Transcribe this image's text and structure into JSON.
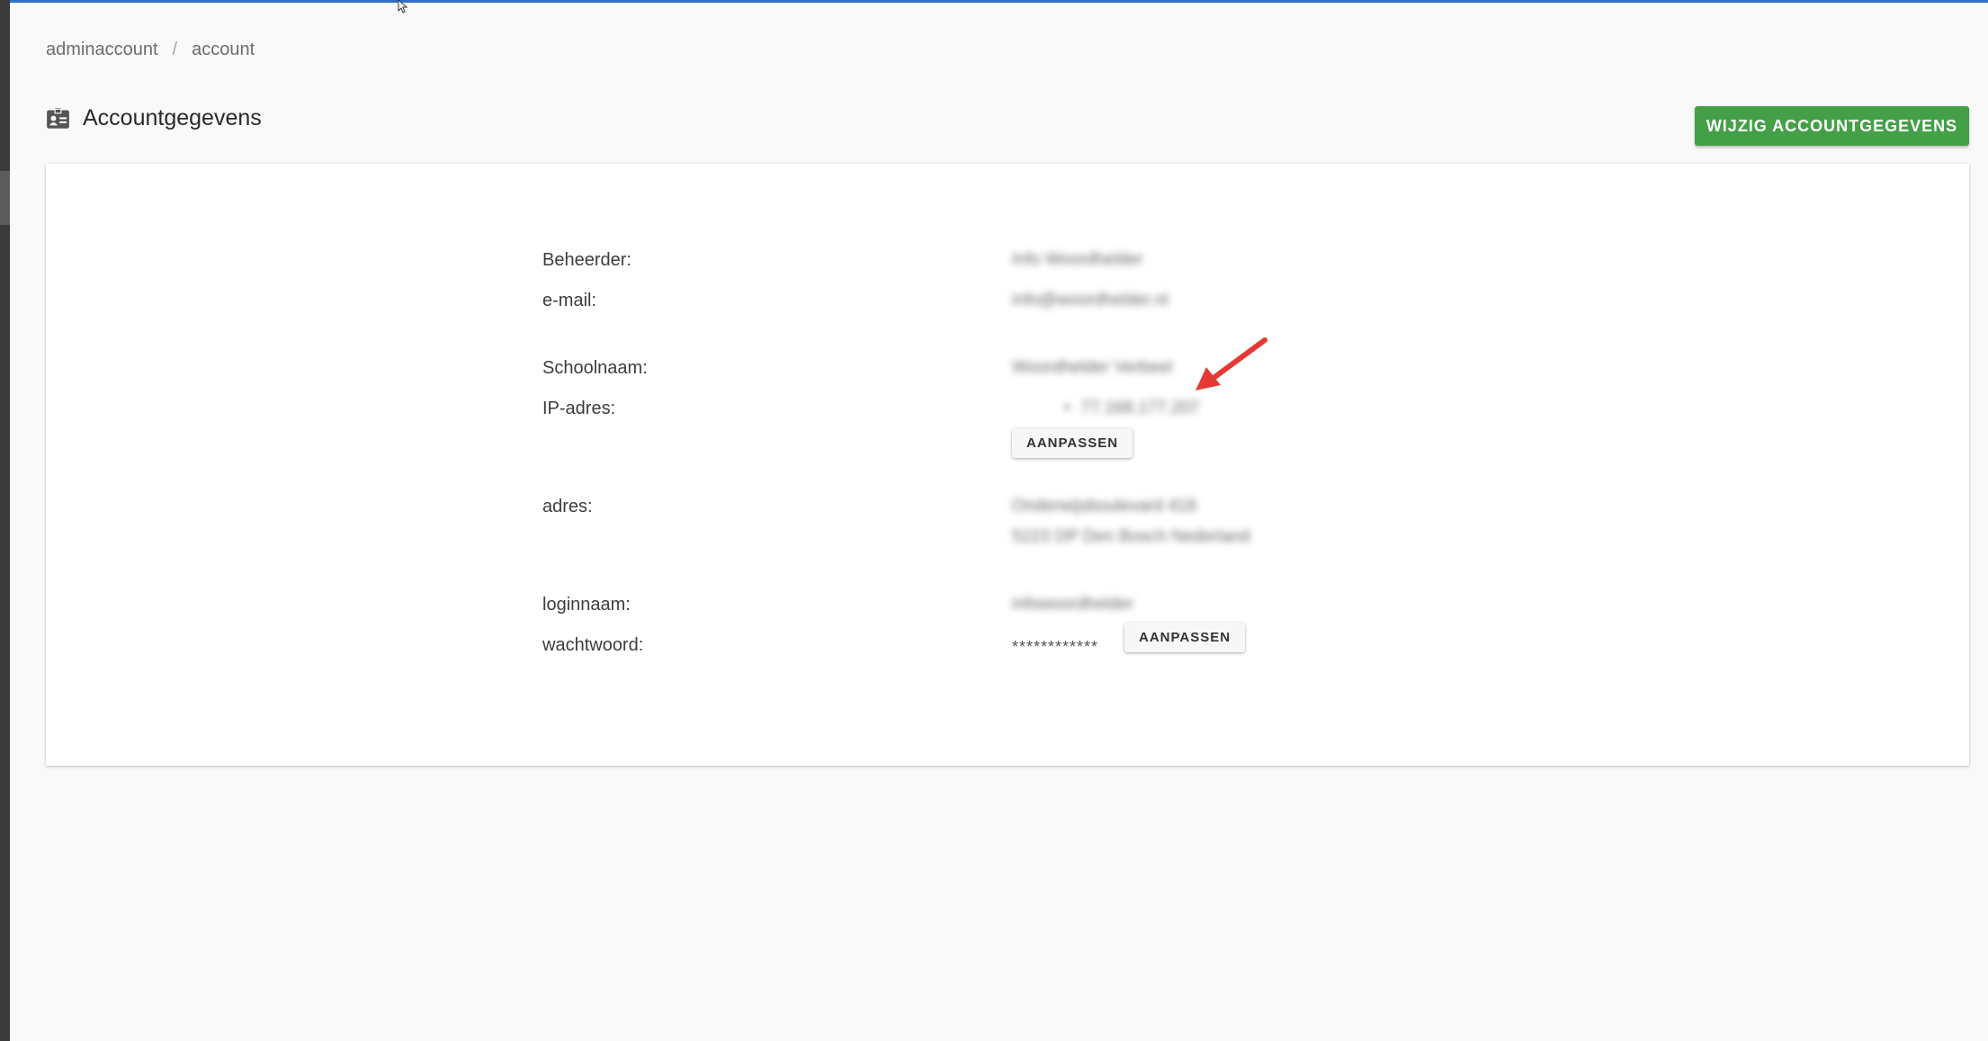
{
  "breadcrumb": {
    "items": [
      "adminaccount",
      "account"
    ],
    "separator": "/"
  },
  "header": {
    "title": "Accountgegevens",
    "icon": "id-card-icon",
    "action_label": "WIJZIG ACCOUNTGEGEVENS",
    "action_color": "#43a047"
  },
  "account": {
    "fields": {
      "beheerder": {
        "label": "Beheerder:",
        "value": "Info Woordhelder"
      },
      "email": {
        "label": "e-mail:",
        "value": "info@woordhelder.nl"
      },
      "schoolnaam": {
        "label": "Schoolnaam:",
        "value": "Woordhelder Verbeel"
      },
      "ip": {
        "label": "IP-adres:",
        "bullet": "•",
        "value": "77.168.177.207",
        "edit_label": "AANPASSEN"
      },
      "adres": {
        "label": "adres:",
        "line1": "Onderwijsboulevard 418",
        "line2": "5223 DP Den Bosch Nederland"
      },
      "loginnaam": {
        "label": "loginnaam:",
        "value": "infowoordhelder"
      },
      "wachtwoord": {
        "label": "wachtwoord:",
        "value": "************",
        "edit_label": "AANPASSEN"
      }
    }
  },
  "annotation": {
    "type": "arrow",
    "color": "#e53935"
  },
  "colors": {
    "accent": "#2f6fc4",
    "background": "#f9f9f9"
  }
}
